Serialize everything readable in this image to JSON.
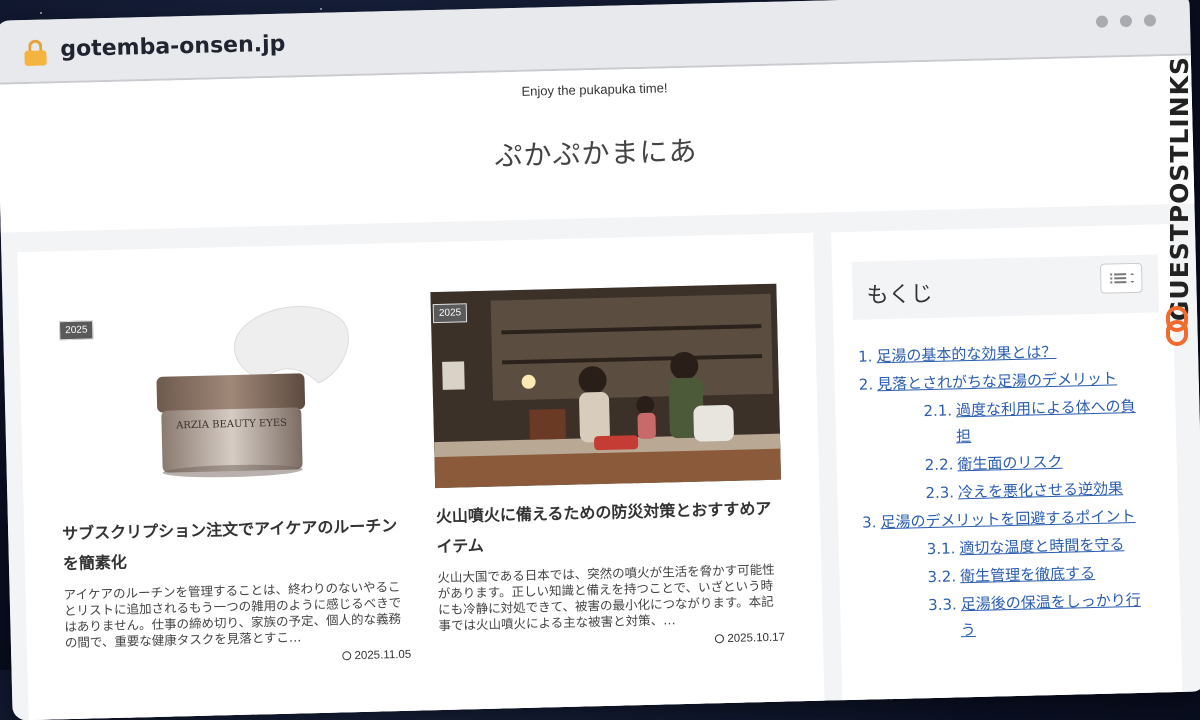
{
  "browser": {
    "domain": "gotemba-onsen.jp"
  },
  "site": {
    "tagline": "Enjoy the pukapuka time!",
    "title": "ぷかぷかまにあ"
  },
  "articles": [
    {
      "badge": "2025",
      "title": "サブスクリプション注文でアイケアのルーチンを簡素化",
      "excerpt": "アイケアのルーチンを管理することは、終わりのないやることリストに追加されるもう一つの雑用のように感じるべきではありません。仕事の締め切り、家族の予定、個人的な義務の間で、重要な健康タスクを見落とすこ…",
      "date": "2025.11.05",
      "image_text": "ARZIA BEAUTY EYES"
    },
    {
      "badge": "2025",
      "title": "火山噴火に備えるための防災対策とおすすめアイテム",
      "excerpt": "火山大国である日本では、突然の噴火が生活を脅かす可能性があります。正しい知識と備えを持つことで、いざという時にも冷静に対処できて、被害の最小化につながります。本記事では火山噴火による主な被害と対策、…",
      "date": "2025.10.17"
    }
  ],
  "toc": {
    "title": "もくじ",
    "items": [
      {
        "num": "1.",
        "text": "足湯の基本的な効果とは？",
        "level": 1
      },
      {
        "num": "2.",
        "text": "見落とされがちな足湯のデメリット",
        "level": 1
      },
      {
        "num": "2.1.",
        "text": "過度な利用による体への負担",
        "level": 2
      },
      {
        "num": "2.2.",
        "text": "衛生面のリスク",
        "level": 2
      },
      {
        "num": "2.3.",
        "text": "冷えを悪化させる逆効果",
        "level": 2
      },
      {
        "num": "3.",
        "text": "足湯のデメリットを回避するポイント",
        "level": 1
      },
      {
        "num": "3.1.",
        "text": "適切な温度と時間を守る",
        "level": 2
      },
      {
        "num": "3.2.",
        "text": "衛生管理を徹底する",
        "level": 2
      },
      {
        "num": "3.3.",
        "text": "足湯後の保温をしっかり行う",
        "level": 2
      }
    ]
  },
  "watermark": {
    "text": "GUESTPOSTLINKS"
  },
  "colors": {
    "link": "#2a5db0",
    "lock": "#f4b43f"
  }
}
